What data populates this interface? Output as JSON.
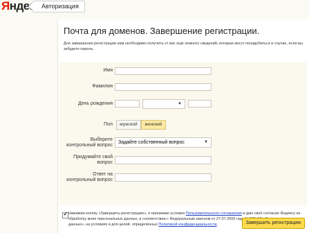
{
  "brand": {
    "logo_first": "Я",
    "logo_rest": "ндекс"
  },
  "breadcrumb": {
    "label": "Авторизация"
  },
  "page": {
    "title": "Почта для доменов. Завершение регистрации.",
    "intro": "Для завершения регистрации нам необходимо получить от вас ещё немного сведений, которые могут понадобиться в случае, если вы забудете пароль."
  },
  "form": {
    "first_name": {
      "label": "Имя",
      "value": ""
    },
    "last_name": {
      "label": "Фамилия",
      "value": ""
    },
    "birthday": {
      "label": "День рождения",
      "day": "",
      "month": "",
      "year": ""
    },
    "gender": {
      "label": "Пол",
      "male": "мужской",
      "female": "женский",
      "selected": "женский"
    },
    "question_select": {
      "label": "Выберите контрольный вопрос",
      "selected": "Задайте собственный вопрос"
    },
    "own_question": {
      "label": "Придумайте свой вопрос",
      "value": ""
    },
    "answer": {
      "label": "Ответ на контрольный вопрос",
      "value": ""
    }
  },
  "consent": {
    "checked": true,
    "text_1": "Нажимая кнопку «Завершить регистрацию», я принимаю условия ",
    "link_1": "Пользовательского соглашения",
    "text_2": " и даю своё согласие Яндексу на обработку моих персональных данных, в соответствии с Федеральным законом от 27.07.2006 года №152-ФЗ «О персональных данных», на условиях и для целей, определённых ",
    "link_2": "Политикой конфиденциальности",
    "text_3": "."
  },
  "submit": {
    "label": "Завершить регистрацию"
  },
  "colors": {
    "accent": "#ffdb4d",
    "logo_red": "#e61400",
    "link": "#1a3dc1",
    "toggle_on": "#fde9a0"
  }
}
